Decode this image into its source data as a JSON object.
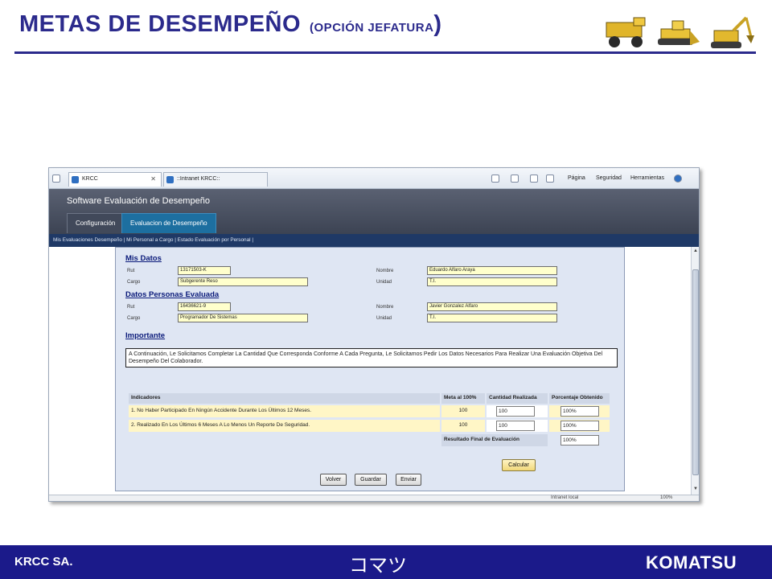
{
  "slide": {
    "title": "METAS DE DESEMPEÑO",
    "subtitle_open": "(",
    "subtitle": "OPCIÓN JEFATURA",
    "subtitle_close": ")",
    "footer_company": "KRCC SA.",
    "footer_kana": "コマツ",
    "footer_logo": "KOMATSU"
  },
  "browser": {
    "tabs": [
      {
        "label": "KRCC"
      },
      {
        "label": "::Intranet KRCC::"
      }
    ],
    "commands": [
      "Página",
      "Seguridad",
      "Herramientas"
    ],
    "status_text": "Intranet local",
    "zoom": "100%"
  },
  "app": {
    "title": "Software Evaluación de Desempeño",
    "tabs": [
      "Configuración",
      "Evaluacion de Desempeño"
    ],
    "subnav": "Mis Evaluaciones Desempeño |  Mi Personal a Cargo |  Estado Evaluación por Personal |"
  },
  "mis_datos": {
    "heading": "Mis Datos",
    "rut_label": "Rut",
    "rut": "13171503-K",
    "nombre_label": "Nombre",
    "nombre": "Eduardo Alfaro Araya",
    "cargo_label": "Cargo",
    "cargo": "Subgerente Reso",
    "unidad_label": "Unidad",
    "unidad": "T.I."
  },
  "evaluada": {
    "heading": "Datos Personas Evaluada",
    "rut_label": "Rut",
    "rut": "16436621-9",
    "nombre_label": "Nombre",
    "nombre": "Javier Gonzalez Alfaro",
    "cargo_label": "Cargo",
    "cargo": "Programador De Sistemas",
    "unidad_label": "Unidad",
    "unidad": "T.I."
  },
  "importante": {
    "heading": "Importante",
    "text": "A Continuación, Le Solicitamos Completar La Cantidad Que Corresponda Conforme A Cada Pregunta, Le Solicitamos Pedir Los Datos Necesarios Para Realizar Una Evaluación Objetiva Del Desempeño Del Colaborador."
  },
  "indicadores": {
    "headers": [
      "Indicadores",
      "Meta al 100%",
      "Cantidad Realizada",
      "Porcentaje Obtenido"
    ],
    "rows": [
      {
        "text": "1. No Haber Participado En Ningún Accidente Durante Los Últimos 12 Meses.",
        "meta": "100",
        "cantidad": "100",
        "porcentaje": "100%"
      },
      {
        "text": "2. Realizado En Los Últimos 6 Meses A Lo Menos Un Reporte De Seguridad.",
        "meta": "100",
        "cantidad": "100",
        "porcentaje": "100%"
      }
    ],
    "resultado_label": "Resultado Final de Evaluación",
    "resultado": "100%"
  },
  "buttons": {
    "calcular": "Calcular",
    "volver": "Volver",
    "guardar": "Guardar",
    "enviar": "Enviar"
  },
  "colors": {
    "brand_blue": "#2b2a8c",
    "footer_blue": "#1b1a8a",
    "field_yellow": "#ffffcc"
  }
}
